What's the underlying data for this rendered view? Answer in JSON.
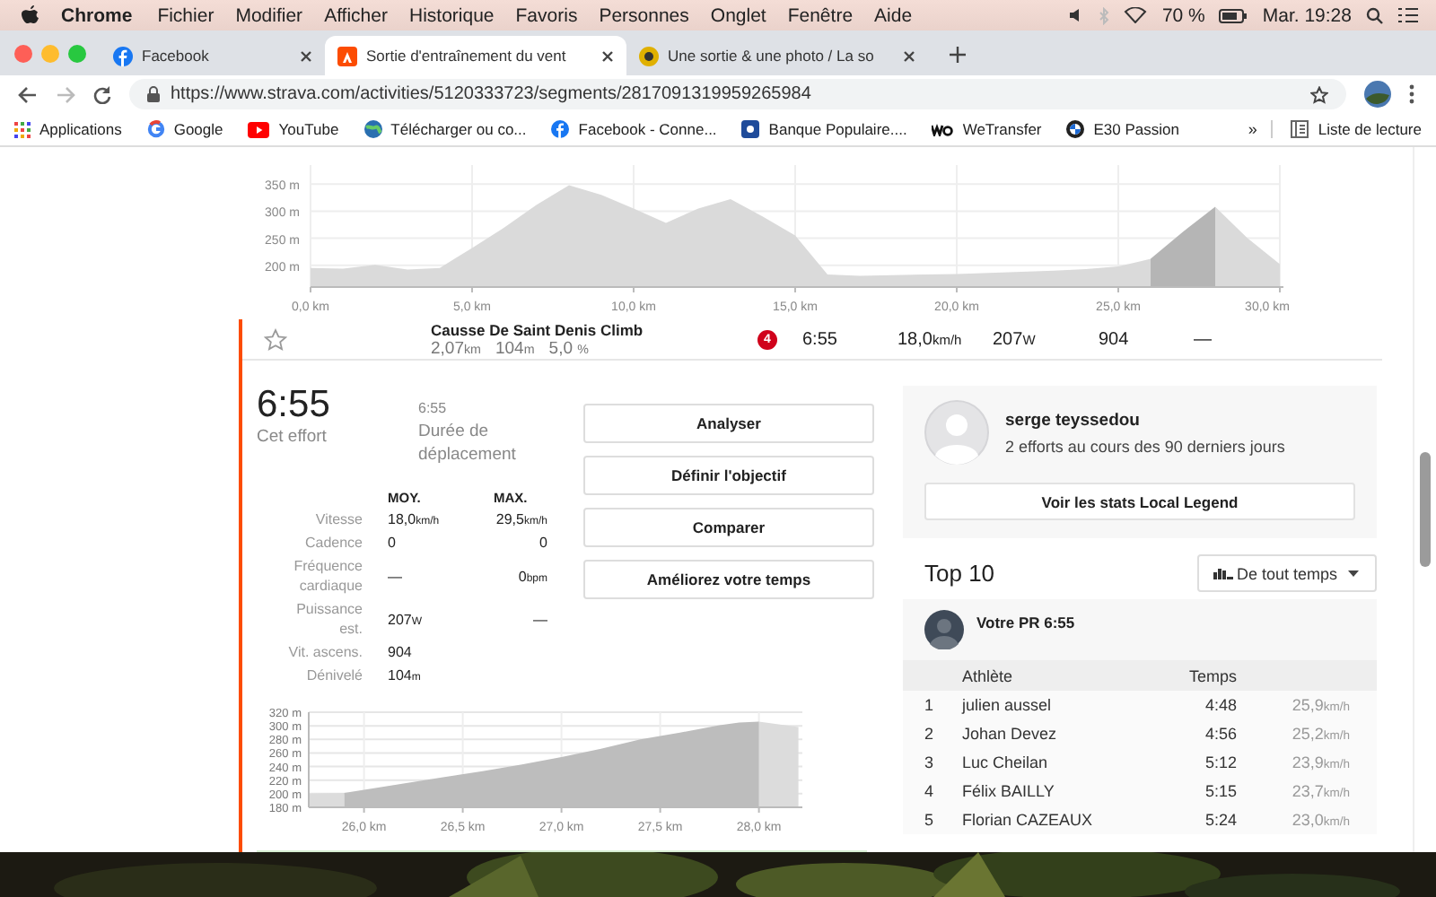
{
  "menu_bar": {
    "app": "Chrome",
    "menus": [
      "Fichier",
      "Modifier",
      "Afficher",
      "Historique",
      "Favoris",
      "Personnes",
      "Onglet",
      "Fenêtre",
      "Aide"
    ],
    "battery": "70 %",
    "clock": "Mar. 19:28"
  },
  "tabs": [
    {
      "title": "Facebook",
      "selected": false
    },
    {
      "title": "Sortie d'entraînement du vent",
      "selected": true
    },
    {
      "title": "Une sortie & une photo / La so",
      "selected": false
    }
  ],
  "address_bar": {
    "url": "https://www.strava.com/activities/5120333723/segments/2817091319959265984"
  },
  "bookmarks": [
    {
      "label": "Applications"
    },
    {
      "label": "Google"
    },
    {
      "label": "YouTube"
    },
    {
      "label": "Télécharger ou co..."
    },
    {
      "label": "Facebook - Conne..."
    },
    {
      "label": "Banque Populaire...."
    },
    {
      "label": "WeTransfer"
    },
    {
      "label": "E30 Passion"
    }
  ],
  "bookmarks_overflow": "»",
  "reading_list": "Liste de lecture",
  "elevation_profile": {
    "chart_data": {
      "type": "area",
      "grid": true,
      "x": [
        0,
        1,
        2,
        3,
        4,
        5,
        6,
        7,
        8,
        9,
        10,
        11,
        12,
        13,
        14,
        15,
        16,
        17,
        18,
        19,
        20,
        21,
        22,
        23,
        24,
        25,
        26,
        27,
        28,
        29,
        30
      ],
      "series": [
        {
          "color": "#dadada",
          "values": [
            195,
            194,
            201,
            192,
            195,
            232,
            270,
            312,
            348,
            330,
            305,
            278,
            305,
            322,
            290,
            255,
            183,
            181,
            182,
            183,
            184,
            186,
            188,
            190,
            193,
            198,
            212,
            null,
            308,
            250,
            202
          ]
        },
        {
          "color": "#b5b5b5",
          "values": [
            null,
            null,
            null,
            null,
            null,
            null,
            null,
            null,
            null,
            null,
            null,
            null,
            null,
            null,
            null,
            null,
            null,
            null,
            null,
            null,
            null,
            null,
            null,
            null,
            null,
            null,
            212,
            262,
            308,
            null,
            null
          ]
        }
      ],
      "xlim": [
        0,
        30
      ],
      "ylim": [
        160,
        385
      ],
      "xticks": [
        {
          "value": 0,
          "label": "0,0 km"
        },
        {
          "value": 5,
          "label": "5,0 km"
        },
        {
          "value": 10,
          "label": "10,0 km"
        },
        {
          "value": 15,
          "label": "15,0 km"
        },
        {
          "value": 20,
          "label": "20,0 km"
        },
        {
          "value": 25,
          "label": "25,0 km"
        },
        {
          "value": 30,
          "label": "30,0 km"
        }
      ],
      "yticks": [
        {
          "value": 200,
          "label": "200 m"
        },
        {
          "value": 250,
          "label": "250 m"
        },
        {
          "value": 300,
          "label": "300 m"
        },
        {
          "value": 350,
          "label": "350 m"
        }
      ]
    }
  },
  "segment": {
    "name": "Causse De Saint Denis Climb",
    "starred": false,
    "distance": "2,07",
    "distance_unit": "km",
    "elevation": "104",
    "elevation_unit": "m",
    "grade": "5,0",
    "grade_unit": "%",
    "badge": "4",
    "time": "6:55",
    "speed": "18,0",
    "speed_unit": "km/h",
    "power": "207",
    "power_unit": "W",
    "vam": "904",
    "heart_rate": "—"
  },
  "effort": {
    "time": "6:55",
    "time_label": "Cet effort",
    "moving_time": "6:55",
    "moving_time_label": "Durée de déplacement"
  },
  "stats": {
    "columns": [
      "MOY.",
      "MAX."
    ],
    "rows": [
      {
        "label": "Vitesse",
        "avg": "18,0",
        "avg_unit": "km/h",
        "max": "29,5",
        "max_unit": "km/h"
      },
      {
        "label": "Cadence",
        "avg": "0",
        "max": "0"
      },
      {
        "label": "Fréquence cardiaque",
        "avg": "—",
        "max": "0",
        "max_unit": "bpm"
      },
      {
        "label": "Puissance est.",
        "avg": "207",
        "avg_unit": "W",
        "max": "—"
      },
      {
        "label": "Vit. ascens.",
        "avg": "904"
      },
      {
        "label": "Dénivelé",
        "avg": "104",
        "avg_unit": "m"
      }
    ]
  },
  "actions": [
    "Analyser",
    "Définir l'objectif",
    "Comparer",
    "Améliorez votre temps"
  ],
  "segment_profile": {
    "chart_data": {
      "type": "area",
      "grid": true,
      "x": [
        25.72,
        25.9,
        26.0,
        26.2,
        26.4,
        26.6,
        26.8,
        27.0,
        27.2,
        27.4,
        27.6,
        27.8,
        27.9,
        28.0,
        28.2
      ],
      "series": [
        {
          "color": "#dcdcdc",
          "values": [
            200,
            201,
            null,
            null,
            null,
            null,
            null,
            null,
            null,
            null,
            null,
            null,
            null,
            306,
            298
          ]
        },
        {
          "color": "#bdbdbd",
          "values": [
            null,
            201,
            206,
            215,
            224,
            233,
            243,
            254,
            266,
            280,
            290,
            301,
            305,
            306,
            null
          ]
        }
      ],
      "xlim": [
        25.72,
        28.22
      ],
      "ylim": [
        180,
        320
      ],
      "xticks": [
        {
          "value": 26,
          "label": "26,0 km"
        },
        {
          "value": 26.5,
          "label": "26,5 km"
        },
        {
          "value": 27,
          "label": "27,0 km"
        },
        {
          "value": 27.5,
          "label": "27,5 km"
        },
        {
          "value": 28,
          "label": "28,0 km"
        }
      ],
      "yticks": [
        {
          "value": 180,
          "label": "180 m"
        },
        {
          "value": 200,
          "label": "200 m"
        },
        {
          "value": 220,
          "label": "220 m"
        },
        {
          "value": 240,
          "label": "240 m"
        },
        {
          "value": 260,
          "label": "260 m"
        },
        {
          "value": 280,
          "label": "280 m"
        },
        {
          "value": 300,
          "label": "300 m"
        },
        {
          "value": 320,
          "label": "320 m"
        }
      ]
    }
  },
  "local_legend": {
    "name": "serge teyssedou",
    "efforts": "2 efforts au cours des 90 derniers jours",
    "button": "Voir les stats Local Legend"
  },
  "leaderboard": {
    "title": "Top 10",
    "filter": "De tout temps",
    "personal_record": "Votre PR 6:55",
    "columns": [
      "Athlète",
      "Temps"
    ],
    "rows": [
      {
        "rank": "1",
        "name": "julien aussel",
        "time": "4:48",
        "speed": "25,9",
        "speed_unit": "km/h"
      },
      {
        "rank": "2",
        "name": "Johan Devez",
        "time": "4:56",
        "speed": "25,2",
        "speed_unit": "km/h"
      },
      {
        "rank": "3",
        "name": "Luc Cheilan",
        "time": "5:12",
        "speed": "23,9",
        "speed_unit": "km/h"
      },
      {
        "rank": "4",
        "name": "Félix BAILLY",
        "time": "5:15",
        "speed": "23,7",
        "speed_unit": "km/h"
      },
      {
        "rank": "5",
        "name": "Florian CAZEAUX",
        "time": "5:24",
        "speed": "23,0",
        "speed_unit": "km/h"
      }
    ]
  }
}
